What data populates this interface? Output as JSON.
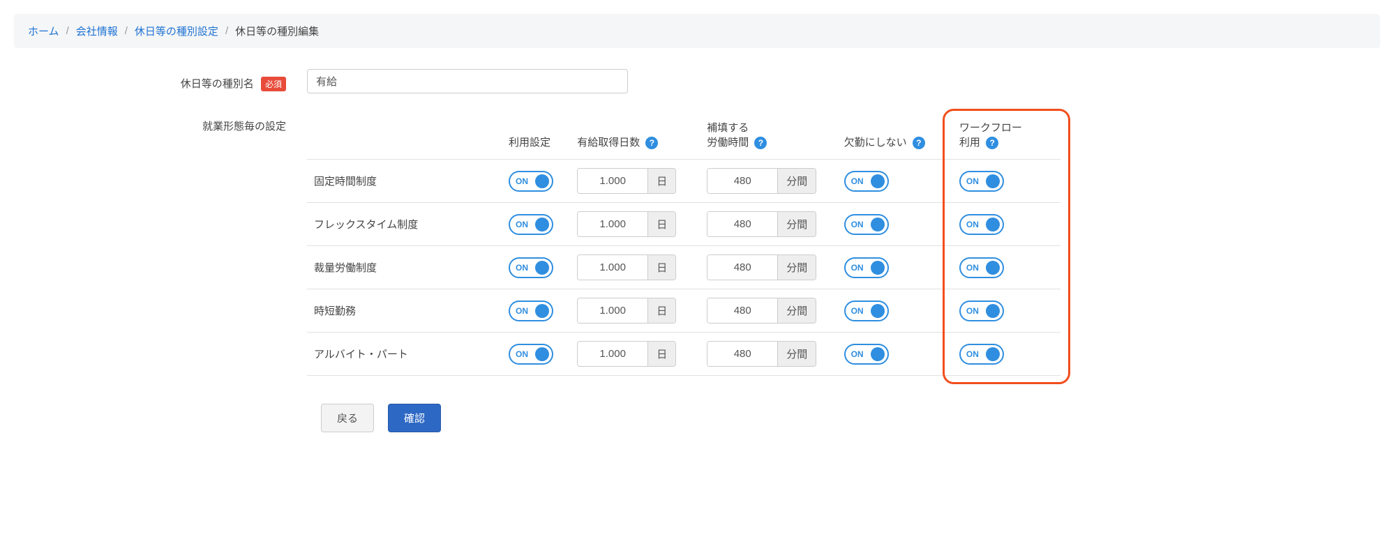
{
  "breadcrumb": {
    "home": "ホーム",
    "company": "会社情報",
    "holiday_settings": "休日等の種別設定",
    "current": "休日等の種別編集"
  },
  "labels": {
    "name_label": "休日等の種別名",
    "required": "必須",
    "per_employment_label": "就業形態毎の設定"
  },
  "name_value": "有給",
  "headers": {
    "usage": "利用設定",
    "paid_days": "有給取得日数",
    "compensate_hours_line1": "補填する",
    "compensate_hours_line2": "労働時間",
    "not_absent": "欠勤にしない",
    "workflow_line1": "ワークフロー",
    "workflow_line2": "利用"
  },
  "units": {
    "day": "日",
    "minutes": "分間"
  },
  "toggle_on": "ON",
  "help_icon": "?",
  "rows": [
    {
      "name": "固定時間制度",
      "days": "1.000",
      "hours": "480"
    },
    {
      "name": "フレックスタイム制度",
      "days": "1.000",
      "hours": "480"
    },
    {
      "name": "裁量労働制度",
      "days": "1.000",
      "hours": "480"
    },
    {
      "name": "時短勤務",
      "days": "1.000",
      "hours": "480"
    },
    {
      "name": "アルバイト・パート",
      "days": "1.000",
      "hours": "480"
    }
  ],
  "buttons": {
    "back": "戻る",
    "confirm": "確認"
  }
}
